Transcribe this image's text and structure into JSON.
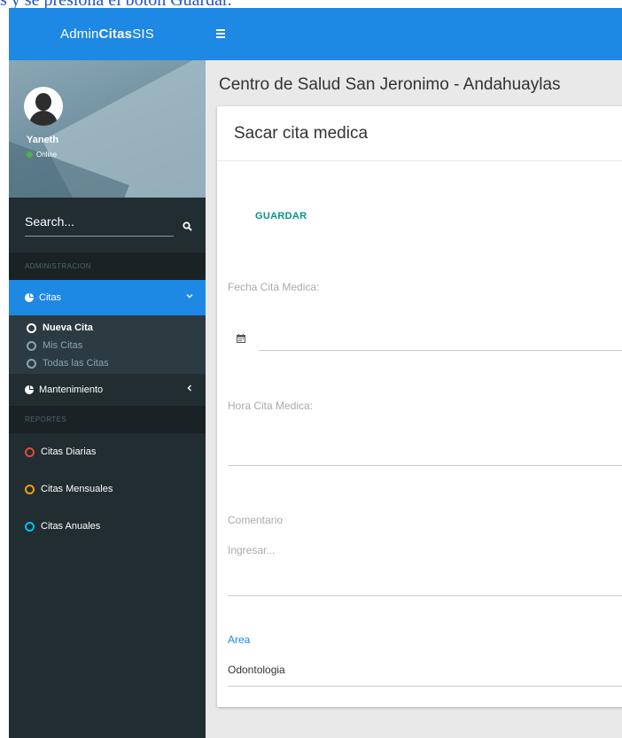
{
  "caption": "s y se presiona el botón Guardar.",
  "brand": {
    "part1": "Admin",
    "part2": "Citas",
    "part3": "SIS"
  },
  "user": {
    "name": "Yaneth",
    "status": "Online"
  },
  "search": {
    "placeholder": "Search..."
  },
  "nav": {
    "section_admin": "ADMINISTRACION",
    "citas_label": "Citas",
    "sub_items": [
      "Nueva Cita",
      "Mis Citas",
      "Todas las Citas"
    ],
    "mantenimiento_label": "Mantenimiento",
    "section_reports": "REPORTES",
    "reports": [
      {
        "label": "Citas Diarias",
        "color": "#dd4b39"
      },
      {
        "label": "Citas Mensuales",
        "color": "#f39c12"
      },
      {
        "label": "Citas Anuales",
        "color": "#00c0ef"
      }
    ]
  },
  "colors": {
    "primary": "#1e88e5",
    "sidebar_bg": "#222d32",
    "save_color": "#009688"
  },
  "page": {
    "title": "Centro de Salud San Jeronimo - Andahuaylas"
  },
  "card": {
    "title": "Sacar cita medica",
    "save_label": "GUARDAR",
    "fecha_label": "Fecha Cita Medica:",
    "hora_label": "Hora Cita Medica:",
    "comentario_label": "Comentario",
    "comentario_placeholder": "Ingresar...",
    "area_label": "Area",
    "area_value": "Odontologia"
  }
}
